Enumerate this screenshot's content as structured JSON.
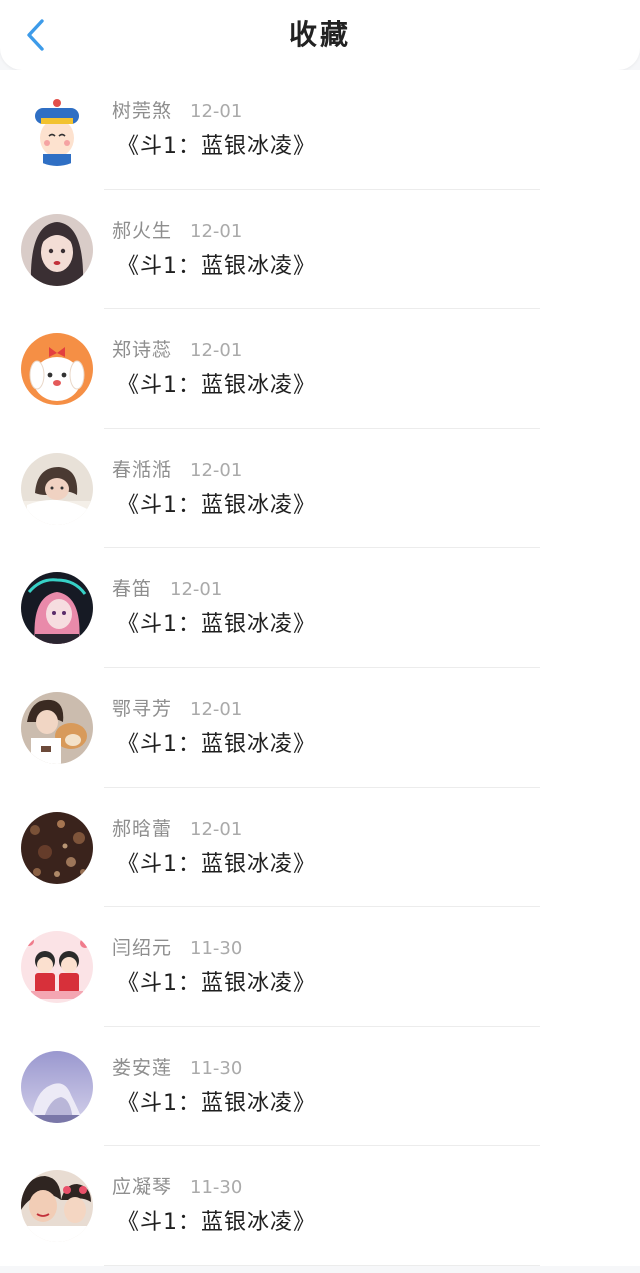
{
  "header": {
    "title": "收藏",
    "back_icon": "chevron-left-icon",
    "accent_color": "#3d9be9"
  },
  "favorites": [
    {
      "name": "树莞煞",
      "date": "12-01",
      "work": "《斗1：蓝银冰凌》",
      "avatar": "cartoon-character"
    },
    {
      "name": "郝火生",
      "date": "12-01",
      "work": "《斗1：蓝银冰凌》",
      "avatar": "girl-portrait"
    },
    {
      "name": "郑诗蕊",
      "date": "12-01",
      "work": "《斗1：蓝银冰凌》",
      "avatar": "cartoon-dog"
    },
    {
      "name": "春湉湉",
      "date": "12-01",
      "work": "《斗1：蓝银冰凌》",
      "avatar": "girl-lying"
    },
    {
      "name": "春笛",
      "date": "12-01",
      "work": "《斗1：蓝银冰凌》",
      "avatar": "anime-pink-hair"
    },
    {
      "name": "鄂寻芳",
      "date": "12-01",
      "work": "《斗1：蓝银冰凌》",
      "avatar": "girl-with-dog"
    },
    {
      "name": "郝晗蕾",
      "date": "12-01",
      "work": "《斗1：蓝银冰凌》",
      "avatar": "glitter-texture"
    },
    {
      "name": "闫绍元",
      "date": "11-30",
      "work": "《斗1：蓝银冰凌》",
      "avatar": "cartoon-couple"
    },
    {
      "name": "娄安莲",
      "date": "11-30",
      "work": "《斗1：蓝银冰凌》",
      "avatar": "sky-building"
    },
    {
      "name": "应凝琴",
      "date": "11-30",
      "work": "《斗1：蓝银冰凌》",
      "avatar": "two-girls-selfie"
    }
  ]
}
